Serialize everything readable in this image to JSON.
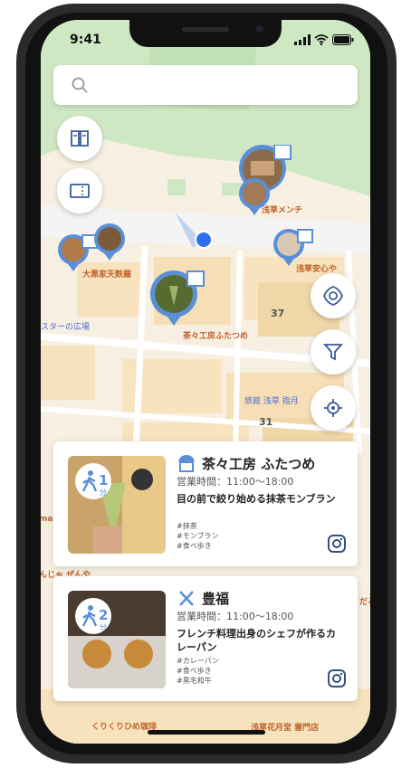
{
  "status_bar": {
    "time": "9:41"
  },
  "map": {
    "labels": {
      "menchi": "浅草メンチ",
      "tenpura": "大黒家天麩羅",
      "anshin": "浅草安心や",
      "hiroba": "スターの広場",
      "futatsume": "茶々工房ふたつめ",
      "ryokan": "旅館 浅草 指月",
      "kurikuri": "くりくりひめ珈琲",
      "kikuya": "浅草花月堂 雷門店",
      "block37": "37",
      "block31": "31",
      "left_frag1": "ma",
      "left_frag2": "んじゃ ぜんや",
      "right_frag": "だる"
    }
  },
  "search": {
    "placeholder": ""
  },
  "cards": [
    {
      "walk_minutes": "1",
      "walk_unit": "分",
      "name": "茶々工房 ふたつめ",
      "hours": "営業時間：11:00〜18:00",
      "description": "目の前で絞り始める抹茶モンブラン",
      "tags": [
        "#抹茶",
        "#モンブラン",
        "#食べ歩き"
      ]
    },
    {
      "walk_minutes": "2",
      "walk_unit": "分",
      "name": "豊福",
      "hours": "営業時間：11:00〜18:00",
      "description": "フレンチ料理出身のシェフが作るカレーパン",
      "tags": [
        "#カレーパン",
        "#食べ歩き",
        "#黒毛和牛"
      ]
    }
  ],
  "colors": {
    "accent": "#5a8fd8",
    "map_label": "#c0622a",
    "user_dot": "#2f6ff0"
  }
}
